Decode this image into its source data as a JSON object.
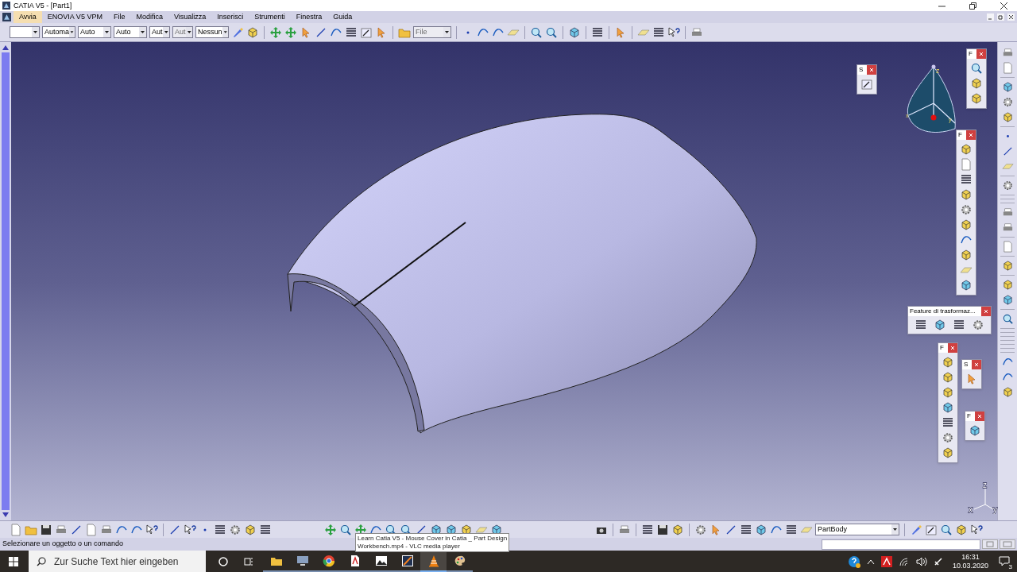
{
  "window": {
    "title": "CATIA V5 - [Part1]"
  },
  "menu": [
    {
      "label": "Avvia",
      "selected": true
    },
    {
      "label": "ENOVIA V5 VPM",
      "selected": false
    },
    {
      "label": "File",
      "selected": false
    },
    {
      "label": "Modifica",
      "selected": false
    },
    {
      "label": "Visualizza",
      "selected": false
    },
    {
      "label": "Inserisci",
      "selected": false
    },
    {
      "label": "Strumenti",
      "selected": false
    },
    {
      "label": "Finestra",
      "selected": false
    },
    {
      "label": "Guida",
      "selected": false
    }
  ],
  "style_combos": [
    {
      "disabled": false
    },
    {
      "value": "Automa",
      "disabled": false
    },
    {
      "value": "Auto",
      "disabled": false
    },
    {
      "value": "Auto",
      "disabled": false
    },
    {
      "value": "Aut",
      "disabled": false
    },
    {
      "value": "Aut",
      "disabled": true
    },
    {
      "value": "Nessun",
      "disabled": false
    }
  ],
  "file_combo": {
    "value": "File",
    "disabled": true
  },
  "floating_toolbars": [
    {
      "title": "S"
    },
    {
      "title": "F"
    },
    {
      "title": "F"
    },
    {
      "title": "Feature di trasformaz..."
    },
    {
      "title": "F"
    },
    {
      "title": "S"
    },
    {
      "title": "F"
    }
  ],
  "compass": {
    "axis_labels": [
      "x",
      "y",
      "z"
    ]
  },
  "axis_triad": {
    "axis_labels": [
      "x",
      "y",
      "z"
    ]
  },
  "part_combo": {
    "value": "PartBody"
  },
  "status_bar": {
    "prompt": "Selezionare un oggetto o un comando"
  },
  "tooltip": {
    "lines": [
      "Learn Catia V5 - Mouse Cover in Catia _ Part Design",
      "Workbench.mp4 - VLC media player"
    ]
  },
  "taskbar": {
    "search_placeholder": "Zur Suche Text hier eingeben",
    "apps": [
      {
        "kind": "folder",
        "selected": false
      },
      {
        "kind": "monitor",
        "selected": false
      },
      {
        "kind": "browser",
        "selected": false
      },
      {
        "kind": "pdf",
        "selected": false
      },
      {
        "kind": "photo",
        "selected": false
      },
      {
        "kind": "video",
        "selected": false
      },
      {
        "kind": "cone",
        "selected": true
      },
      {
        "kind": "palette",
        "selected": false
      }
    ],
    "time": "16:31",
    "date": "10.03.2020",
    "notifications": "3"
  }
}
